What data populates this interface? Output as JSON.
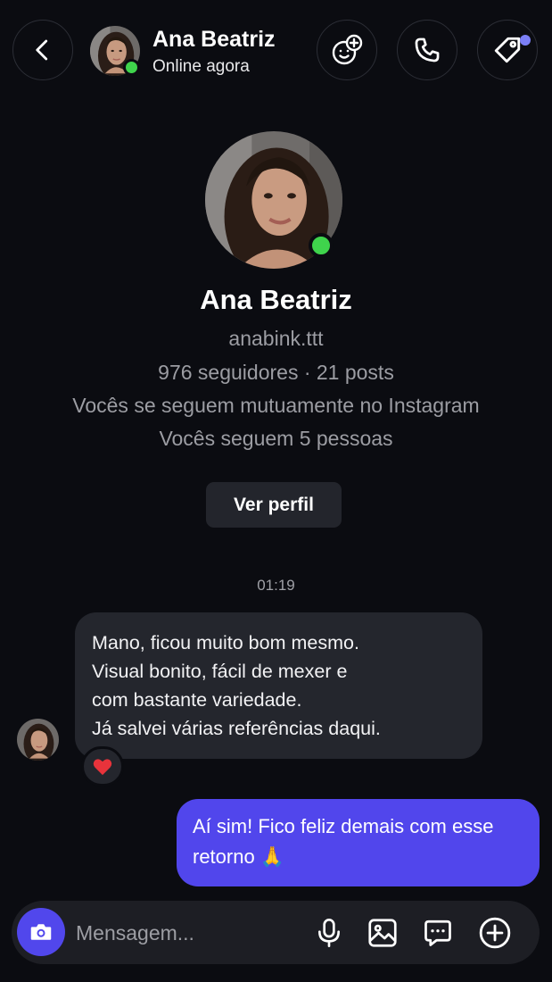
{
  "header": {
    "name": "Ana Beatriz",
    "status": "Online agora"
  },
  "profile": {
    "name": "Ana Beatriz",
    "handle": "anabink.ttt",
    "stats": "976 seguidores · 21 posts",
    "mutual": "Vocês se seguem mutuamente no Instagram",
    "follow_info": "Vocês seguem 5 pessoas",
    "button_label": "Ver perfil"
  },
  "chat": {
    "timestamp": "01:19",
    "incoming": {
      "lines": [
        "Mano, ficou muito bom mesmo.",
        "Visual bonito, fácil de mexer e",
        "com bastante variedade.",
        "Já salvei várias referências daqui."
      ],
      "reaction": "❤️"
    },
    "outgoing": {
      "lines": [
        "Aí sim! Fico feliz demais com esse",
        "retorno 🙏"
      ]
    }
  },
  "composer": {
    "placeholder": "Mensagem..."
  },
  "icons": {
    "back": "chevron-left-icon",
    "add_people": "add-people-icon",
    "call": "phone-icon",
    "tag": "tag-icon",
    "camera": "camera-icon",
    "mic": "microphone-icon",
    "gallery": "image-icon",
    "sticker": "chat-bubble-icon",
    "plus": "plus-circle-icon"
  },
  "colors": {
    "background": "#0b0c11",
    "accent": "#5146ec",
    "online": "#3fd44c",
    "notification_dot": "#7b7ff6",
    "incoming_bubble": "#24262d"
  }
}
